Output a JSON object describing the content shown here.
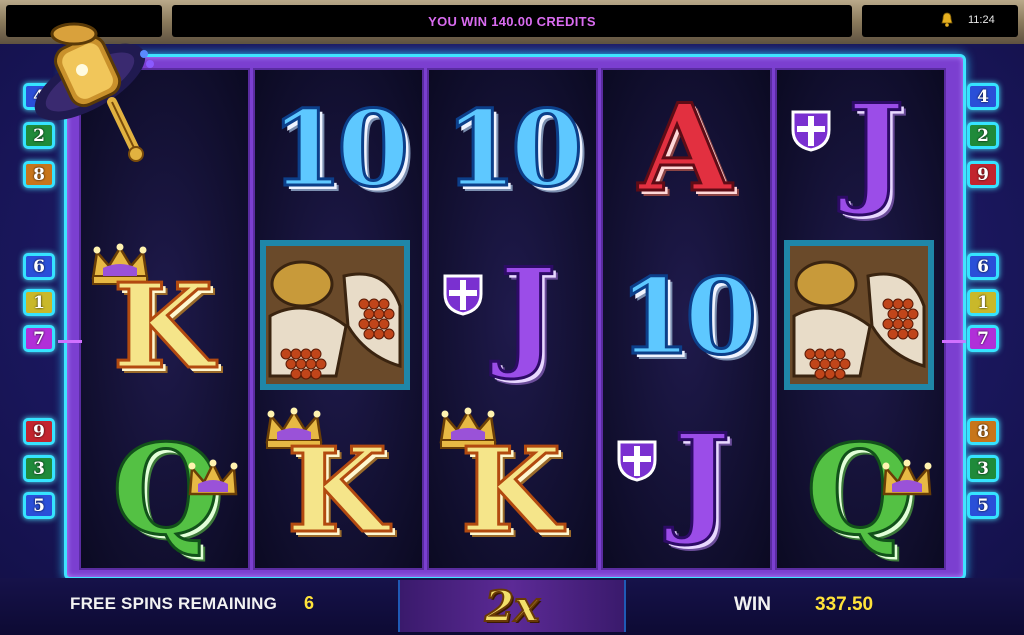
{
  "top_bar": {
    "message": "YOU WIN 140.00 CREDITS",
    "time": "11:24",
    "icon": "bell-icon"
  },
  "paylines": {
    "left": [
      {
        "number": "4",
        "color": "#2a4fd8"
      },
      {
        "number": "2",
        "color": "#1f8a3a"
      },
      {
        "number": "8",
        "color": "#c7751a"
      },
      {
        "number": "6",
        "color": "#2a4fd8"
      },
      {
        "number": "1",
        "color": "#c9b82a"
      },
      {
        "number": "7",
        "color": "#b12fd8"
      },
      {
        "number": "9",
        "color": "#c2242e"
      },
      {
        "number": "3",
        "color": "#1f8a3a"
      },
      {
        "number": "5",
        "color": "#2a4fd8"
      }
    ],
    "right": [
      {
        "number": "4",
        "color": "#2a4fd8"
      },
      {
        "number": "2",
        "color": "#1f8a3a"
      },
      {
        "number": "9",
        "color": "#c2242e"
      },
      {
        "number": "6",
        "color": "#2a4fd8"
      },
      {
        "number": "1",
        "color": "#c9b82a"
      },
      {
        "number": "7",
        "color": "#b12fd8"
      },
      {
        "number": "8",
        "color": "#c7751a"
      },
      {
        "number": "3",
        "color": "#1f8a3a"
      },
      {
        "number": "5",
        "color": "#2a4fd8"
      }
    ]
  },
  "reels": [
    [
      "prayer-drum",
      "K",
      "Q"
    ],
    [
      "10",
      "stones",
      "K"
    ],
    [
      "10",
      "J",
      "K"
    ],
    [
      "A",
      "10",
      "J"
    ],
    [
      "J",
      "stones",
      "Q"
    ]
  ],
  "symbols": {
    "10": "10",
    "A": "A",
    "J": "J",
    "K": "K",
    "Q": "Q"
  },
  "bottom_bar": {
    "free_spins_label": "FREE SPINS REMAINING",
    "free_spins_value": "6",
    "multiplier": "2x",
    "win_label": "WIN",
    "win_value": "337.50"
  }
}
